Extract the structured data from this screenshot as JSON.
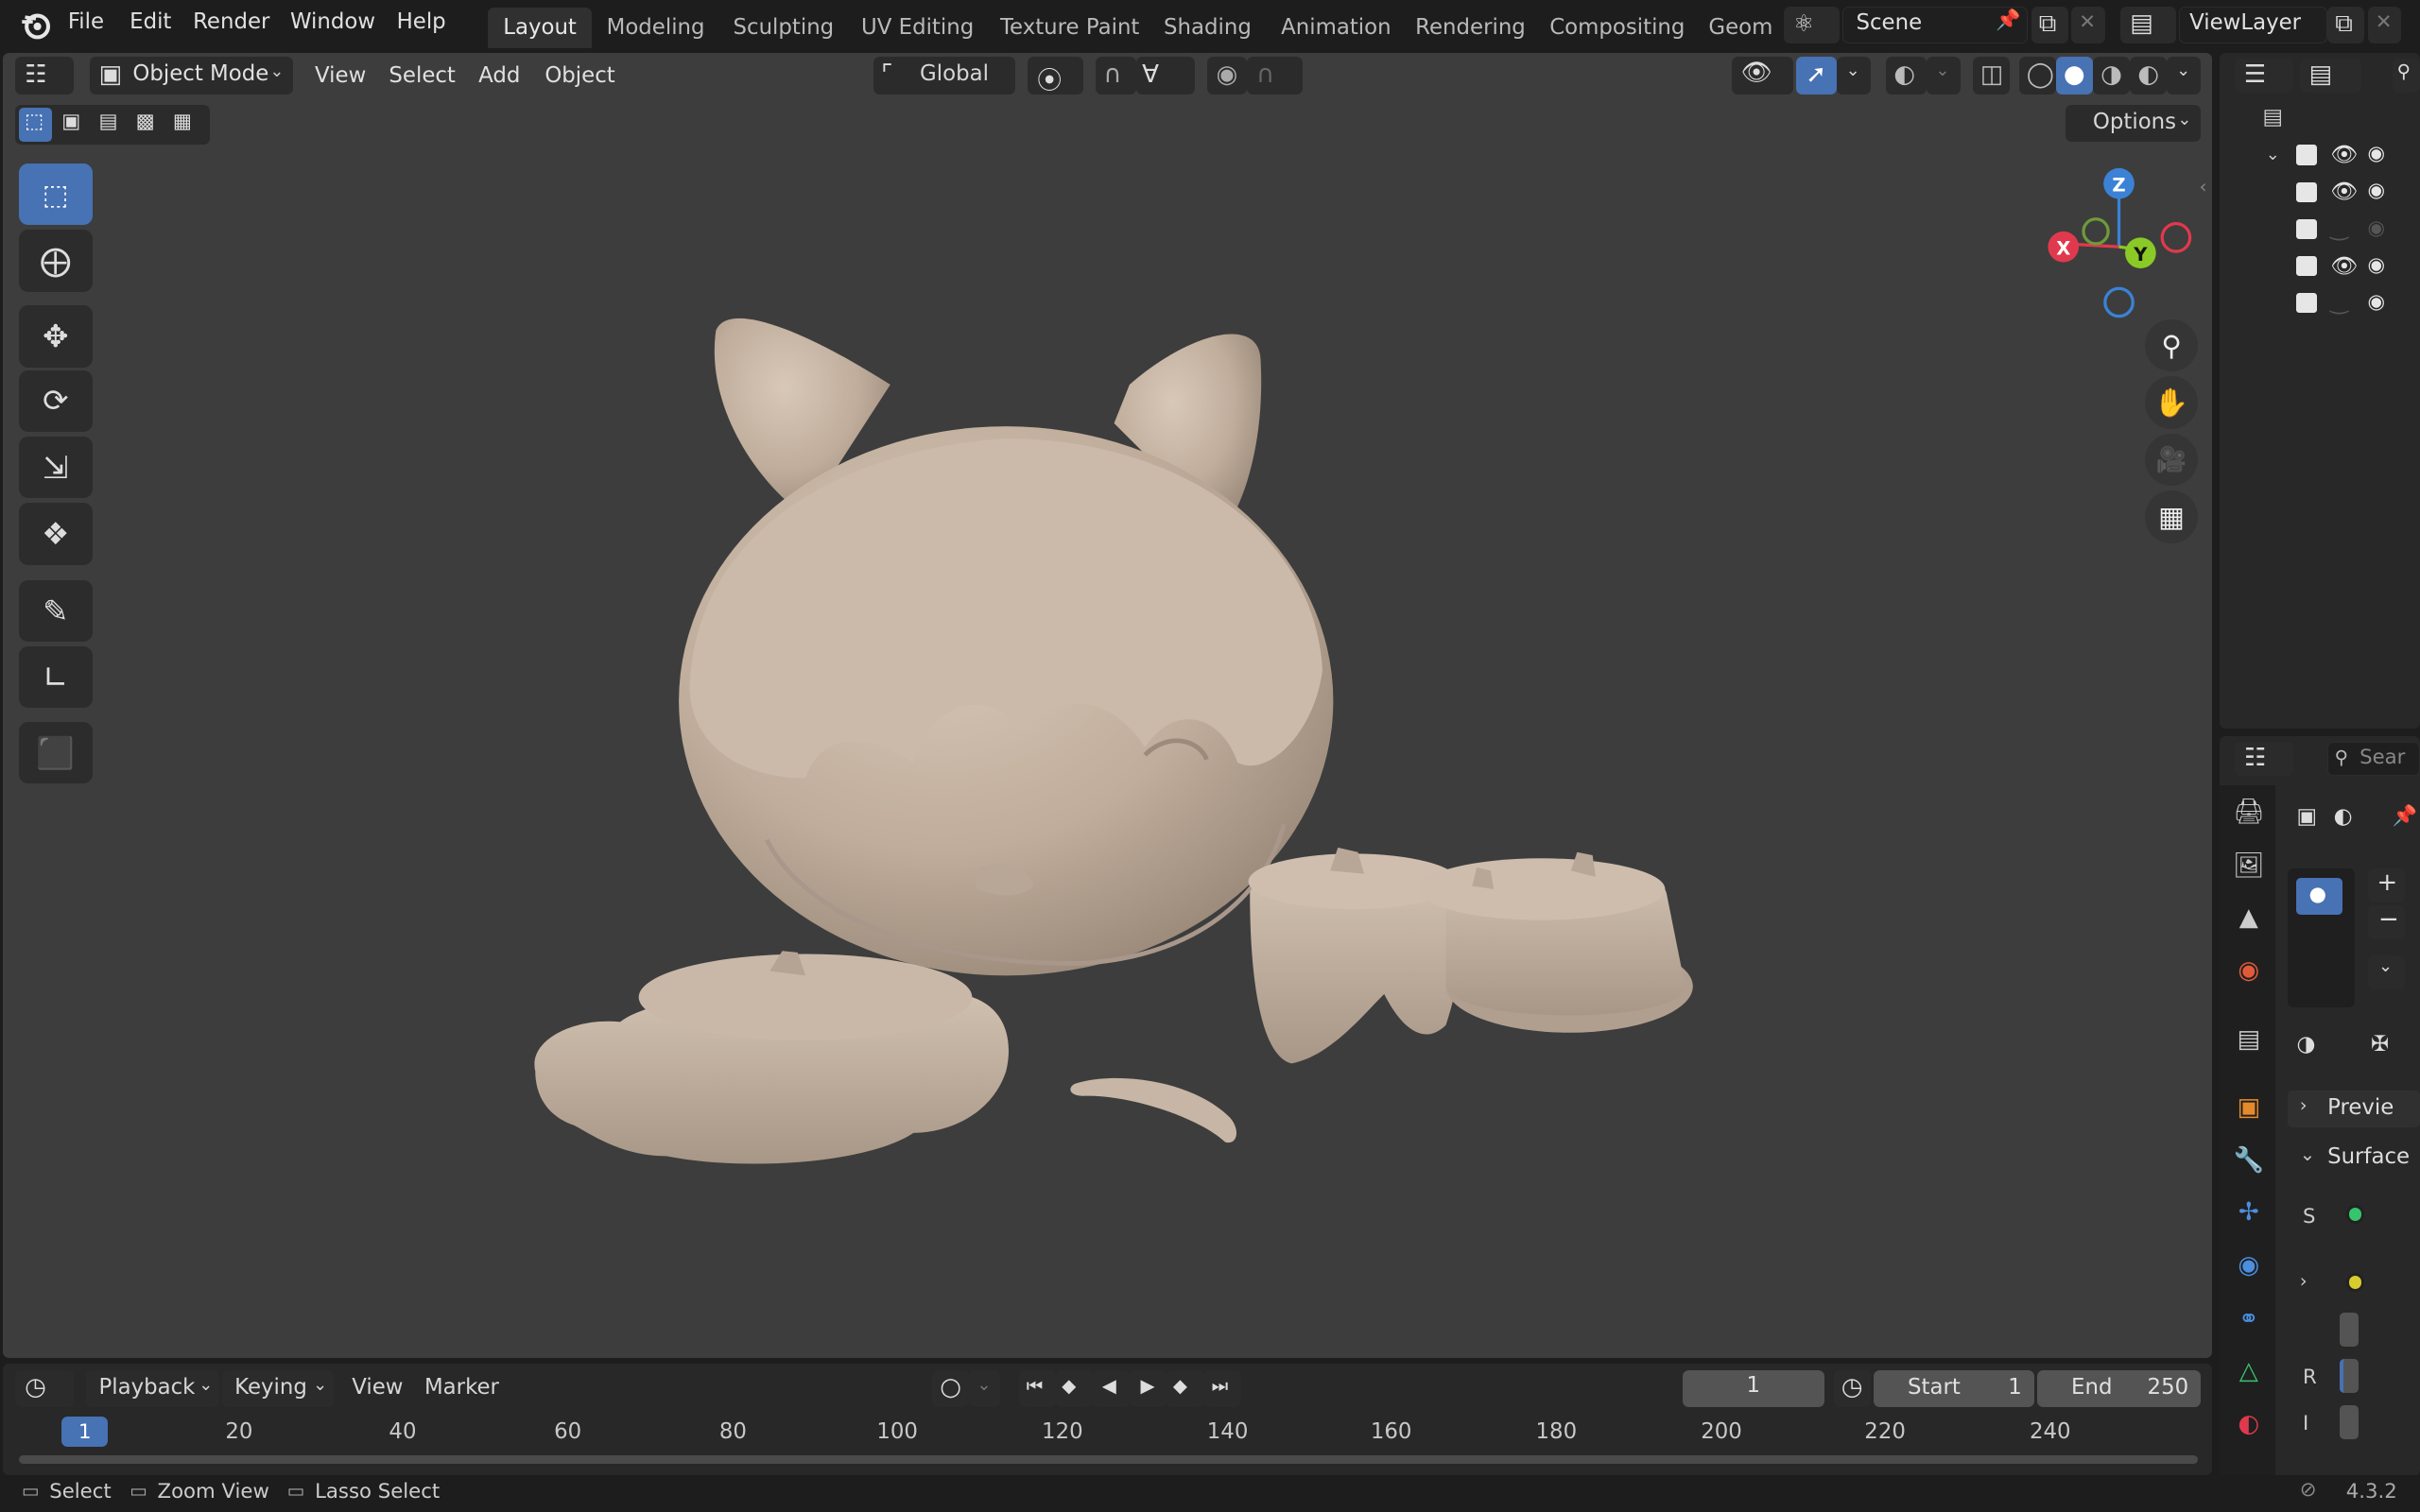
{
  "topbar": {
    "menus": [
      "File",
      "Edit",
      "Render",
      "Window",
      "Help"
    ],
    "workspaces": [
      "Layout",
      "Modeling",
      "Sculpting",
      "UV Editing",
      "Texture Paint",
      "Shading",
      "Animation",
      "Rendering",
      "Compositing",
      "Geom"
    ],
    "active_workspace": "Layout",
    "scene_name": "Scene",
    "view_layer": "ViewLayer"
  },
  "viewport_header": {
    "mode": "Object Mode",
    "menus": [
      "View",
      "Select",
      "Add",
      "Object"
    ],
    "orientation": "Global",
    "options_label": "Options"
  },
  "gizmo": {
    "x": "X",
    "y": "Y",
    "z": "Z"
  },
  "timeline": {
    "menus": [
      "Playback",
      "Keying",
      "View",
      "Marker"
    ],
    "current_frame": "1",
    "start_label": "Start",
    "start_value": "1",
    "end_label": "End",
    "end_value": "250",
    "ticks": [
      "20",
      "40",
      "60",
      "80",
      "100",
      "120",
      "140",
      "160",
      "180",
      "200",
      "220",
      "240"
    ],
    "playhead_label": "1"
  },
  "properties": {
    "search_placeholder": "Sear",
    "preview_label": "Previe",
    "surface_label": "Surface",
    "row_s": "S",
    "row_r": "R",
    "row_i": "I"
  },
  "statusbar": {
    "select": "Select",
    "zoom_view": "Zoom View",
    "lasso_select": "Lasso Select",
    "version": "4.3.2"
  },
  "colors": {
    "accent": "#4772b3",
    "viewport_bg": "#3d3d3d",
    "clay": "#c4b3a3",
    "axis_x": "#e0394d",
    "axis_y": "#8ac926",
    "axis_z": "#3b82d6"
  }
}
